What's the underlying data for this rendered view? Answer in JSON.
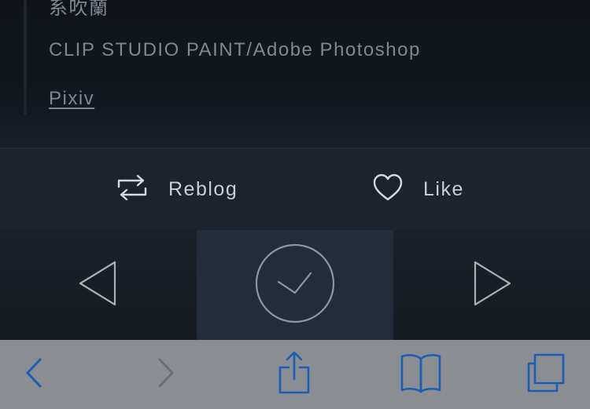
{
  "post": {
    "lines": [
      "系吹蘭",
      "CLIP STUDIO PAINT/Adobe Photoshop"
    ],
    "link": "Pixiv"
  },
  "actions": {
    "reblog_label": "Reblog",
    "like_label": "Like"
  },
  "nav": {
    "prev_icon": "triangle-left-icon",
    "done_icon": "circle-check-icon",
    "next_icon": "triangle-right-icon"
  },
  "browser_toolbar": {
    "icons": [
      "back-arrow-icon",
      "forward-arrow-icon",
      "share-icon",
      "bookmarks-icon",
      "tabs-icon"
    ],
    "active_color": "#1a5fb4",
    "disabled_color": "#6b6f74"
  },
  "colors": {
    "background": "#14181d",
    "action_bar": "#1c232c",
    "nav_active": "#232d39",
    "toolbar": "#8a8e93"
  }
}
